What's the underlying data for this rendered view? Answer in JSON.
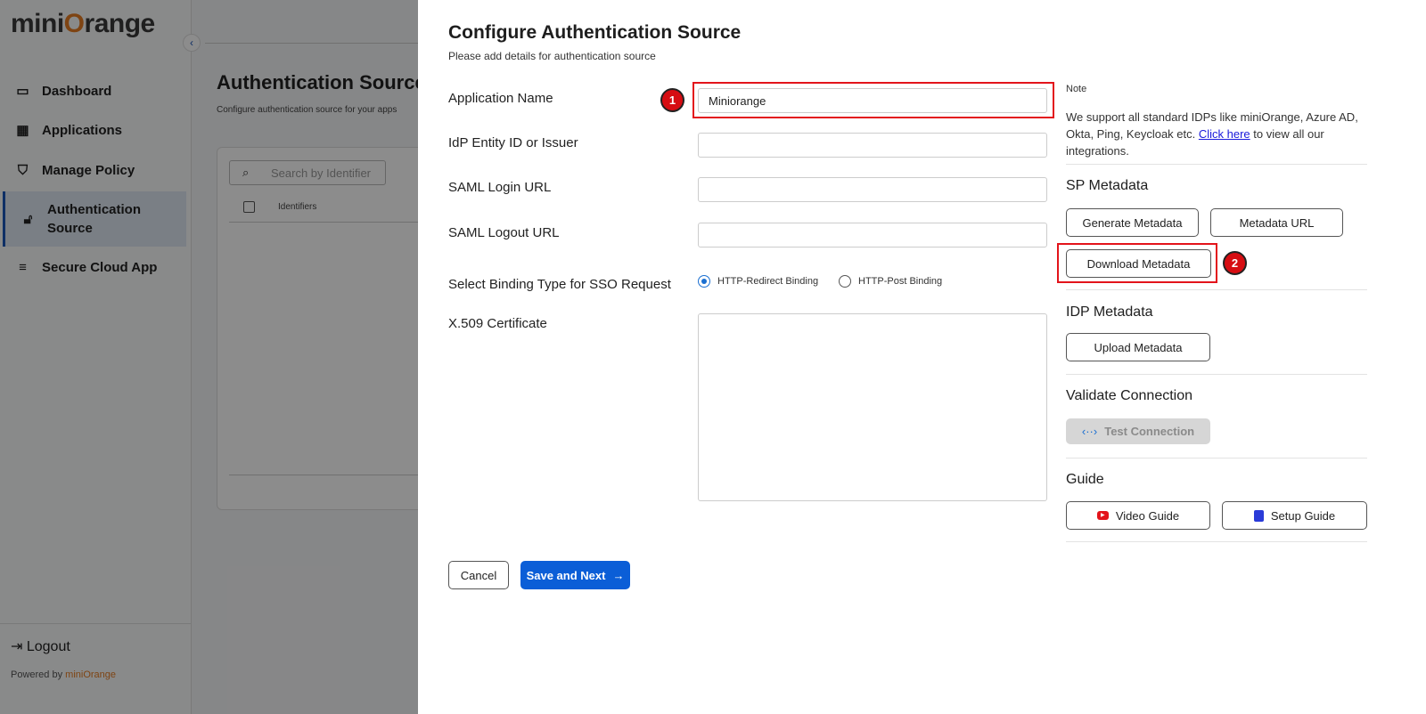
{
  "sidebar": {
    "logo": {
      "pre": "mini",
      "o": "O",
      "post": "range"
    },
    "items": [
      {
        "label": "Dashboard",
        "icon": "laptop-icon"
      },
      {
        "label": "Applications",
        "icon": "grid-icon"
      },
      {
        "label": "Manage Policy",
        "icon": "shield-icon"
      },
      {
        "label": "Authentication Source",
        "icon": "lock-icon",
        "active": true
      },
      {
        "label": "Secure Cloud App",
        "icon": "list-icon"
      }
    ],
    "logout": "Logout",
    "powered_by": "Powered by",
    "powered_brand": "miniOrange"
  },
  "background": {
    "title": "Authentication Source",
    "subtitle": "Configure authentication source for your apps",
    "search_placeholder": "Search by Identifier",
    "column": "Identifiers"
  },
  "modal": {
    "title": "Configure Authentication Source",
    "subtitle": "Please add details for authentication source",
    "fields": {
      "app_name_label": "Application Name",
      "app_name_value": "Miniorange",
      "idp_entity_label": "IdP Entity ID or Issuer",
      "saml_login_label": "SAML Login URL",
      "saml_logout_label": "SAML Logout URL",
      "binding_label": "Select Binding Type for SSO Request",
      "binding_options": [
        "HTTP-Redirect Binding",
        "HTTP-Post Binding"
      ],
      "binding_selected": "HTTP-Redirect Binding",
      "cert_label": "X.509 Certificate"
    },
    "cancel": "Cancel",
    "save": "Save and Next",
    "note_title": "Note",
    "note_text": "We support all standard IDPs like  miniOrange, Azure AD, Okta, Ping, Keycloak etc.",
    "note_link": "Click here",
    "note_after": " to view all our integrations.",
    "sp_metadata": "SP Metadata",
    "generate_metadata": "Generate Metadata",
    "metadata_url": "Metadata URL",
    "download_metadata": "Download Metadata",
    "idp_metadata": "IDP Metadata",
    "upload_metadata": "Upload Metadata",
    "validate": "Validate Connection",
    "test_connection": "Test Connection",
    "guide": "Guide",
    "video_guide": "Video Guide",
    "setup_guide": "Setup Guide"
  },
  "annotations": {
    "step1": "1",
    "step2": "2",
    "highlight_color": "#e3141b"
  },
  "colors": {
    "primary": "#0b5ed7",
    "brand": "#e57c23"
  }
}
